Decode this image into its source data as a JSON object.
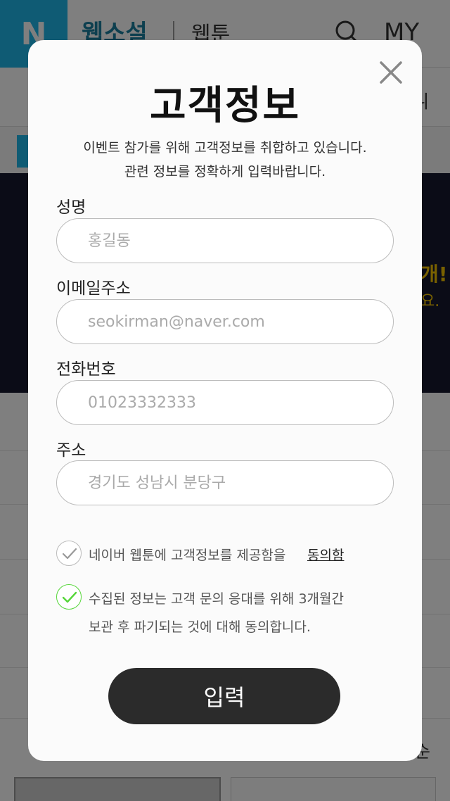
{
  "background": {
    "logo": "N",
    "site_title": "웹소설",
    "site_sub": "웹툰",
    "my_label": "MY",
    "nav_end": "ㅢ",
    "banner_line1": "개!",
    "banner_line2": "요.",
    "footer_text": "순",
    "search_icon": "search-icon"
  },
  "modal": {
    "title": "고객정보",
    "desc_line1": "이벤트 참가를 위해 고객정보를 취합하고 있습니다.",
    "desc_line2": "관련 정보를 정확하게 입력바랍니다.",
    "close_icon": "close-icon",
    "fields": [
      {
        "label": "성명",
        "placeholder": "홍길동"
      },
      {
        "label": "이메일주소",
        "placeholder": "seokirman@naver.com"
      },
      {
        "label": "전화번호",
        "placeholder": "01023332333"
      },
      {
        "label": "주소",
        "placeholder": "경기도 성남시 분당구"
      }
    ],
    "agreements": [
      {
        "text": "네이버 웹툰에 고객정보를 제공함을",
        "link": "동의함",
        "checked": false
      },
      {
        "line1": "수집된 정보는 고객 문의 응대를 위해 3개월간",
        "line2": "보관 후 파기되는 것에 대해 동의합니다.",
        "checked": true
      }
    ],
    "submit_label": "입력"
  },
  "colors": {
    "accent": "#1fb7e8",
    "check_on": "#56d63a",
    "button_bg": "#2b2b2b"
  }
}
